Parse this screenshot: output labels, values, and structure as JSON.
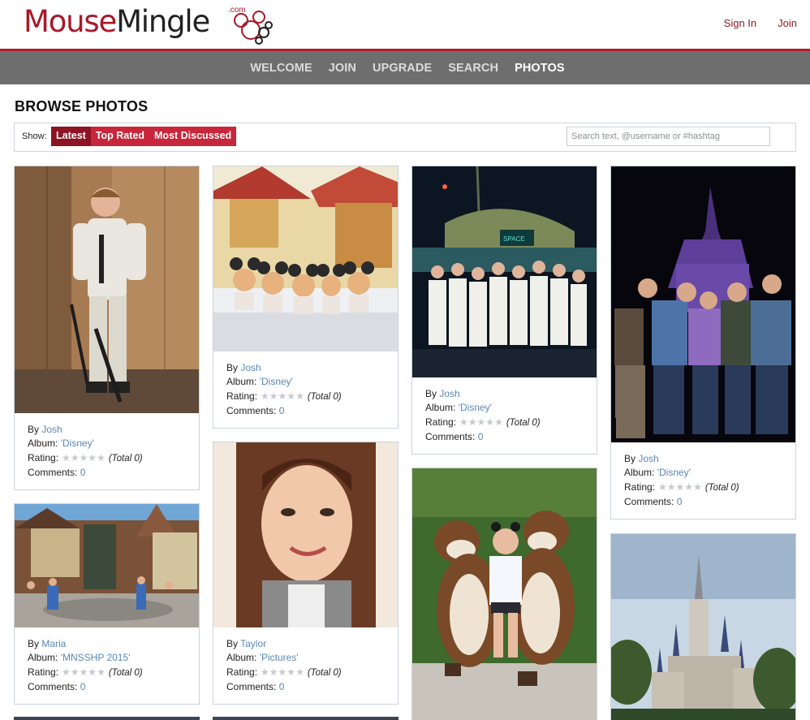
{
  "header": {
    "logo_main": "Mouse",
    "logo_second": "Mingle",
    "logo_com": ".com",
    "sign_in": "Sign In",
    "join": "Join"
  },
  "nav": {
    "items": [
      "WELCOME",
      "JOIN",
      "UPGRADE",
      "SEARCH",
      "PHOTOS"
    ],
    "active": "PHOTOS"
  },
  "page_title": "BROWSE PHOTOS",
  "filter": {
    "show_label": "Show:",
    "tabs": [
      "Latest",
      "Top Rated",
      "Most Discussed"
    ],
    "active": "Latest",
    "search_placeholder": "Search text, @username or #hashtag"
  },
  "labels": {
    "by": "By ",
    "album": "Album: ",
    "rating": "Rating:",
    "comments": "Comments: "
  },
  "photos": [
    {
      "user": "Josh",
      "album": "Disney",
      "total": "(Total 0)",
      "comments": "0",
      "subject": "cast member with segway"
    },
    {
      "user": "Josh",
      "album": "Disney",
      "total": "(Total 0)",
      "comments": "0",
      "subject": "vinylmation figures"
    },
    {
      "user": "Josh",
      "album": "Disney",
      "total": "(Total 0)",
      "comments": "0",
      "subject": "group at space mountain"
    },
    {
      "user": "Josh",
      "album": "Disney",
      "total": "(Total 0)",
      "comments": "0",
      "subject": "friends at castle at night"
    },
    {
      "user": "Maria",
      "album": "MNSSHP 2015",
      "total": "(Total 0)",
      "comments": "0",
      "subject": "fantasyland statue"
    },
    {
      "user": "Taylor",
      "album": "Pictures",
      "total": "(Total 0)",
      "comments": "0",
      "subject": "selfie"
    },
    {
      "user": "",
      "album": "",
      "total": "",
      "comments": "",
      "subject": "chip and dale"
    },
    {
      "user": "",
      "album": "",
      "total": "",
      "comments": "",
      "subject": "cinderella castle"
    }
  ],
  "colors": {
    "brand_red": "#a8182a",
    "nav_gray": "#6e6e6e",
    "filter_red": "#c8263a",
    "filter_active": "#8c1423",
    "link_blue": "#5a87b5"
  }
}
